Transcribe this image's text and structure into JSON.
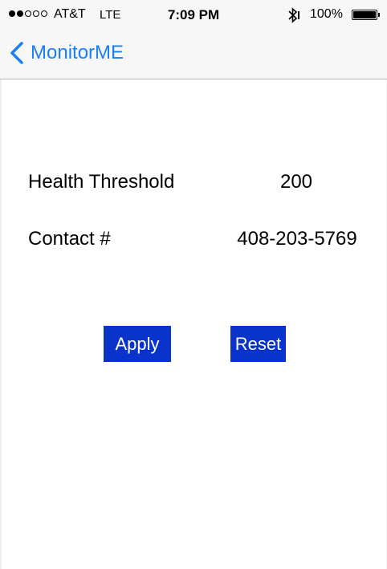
{
  "status_bar": {
    "signal_filled": 2,
    "signal_total": 5,
    "carrier": "AT&T",
    "network": "LTE",
    "time": "7:09 PM",
    "bluetooth_icon": "bluetooth-icon",
    "battery_percent": "100%",
    "battery_level": 1.0
  },
  "nav": {
    "back_icon": "chevron-left-icon",
    "back_label": "MonitorME"
  },
  "form": {
    "health_threshold_label": "Health Threshold",
    "health_threshold_value": "200",
    "contact_label": "Contact #",
    "contact_value": "408-203-5769"
  },
  "buttons": {
    "apply_label": "Apply",
    "reset_label": "Reset"
  },
  "colors": {
    "accent": "#1a7ff6",
    "button_bg": "#0a33cc",
    "bar_bg": "#f7f7f7"
  }
}
